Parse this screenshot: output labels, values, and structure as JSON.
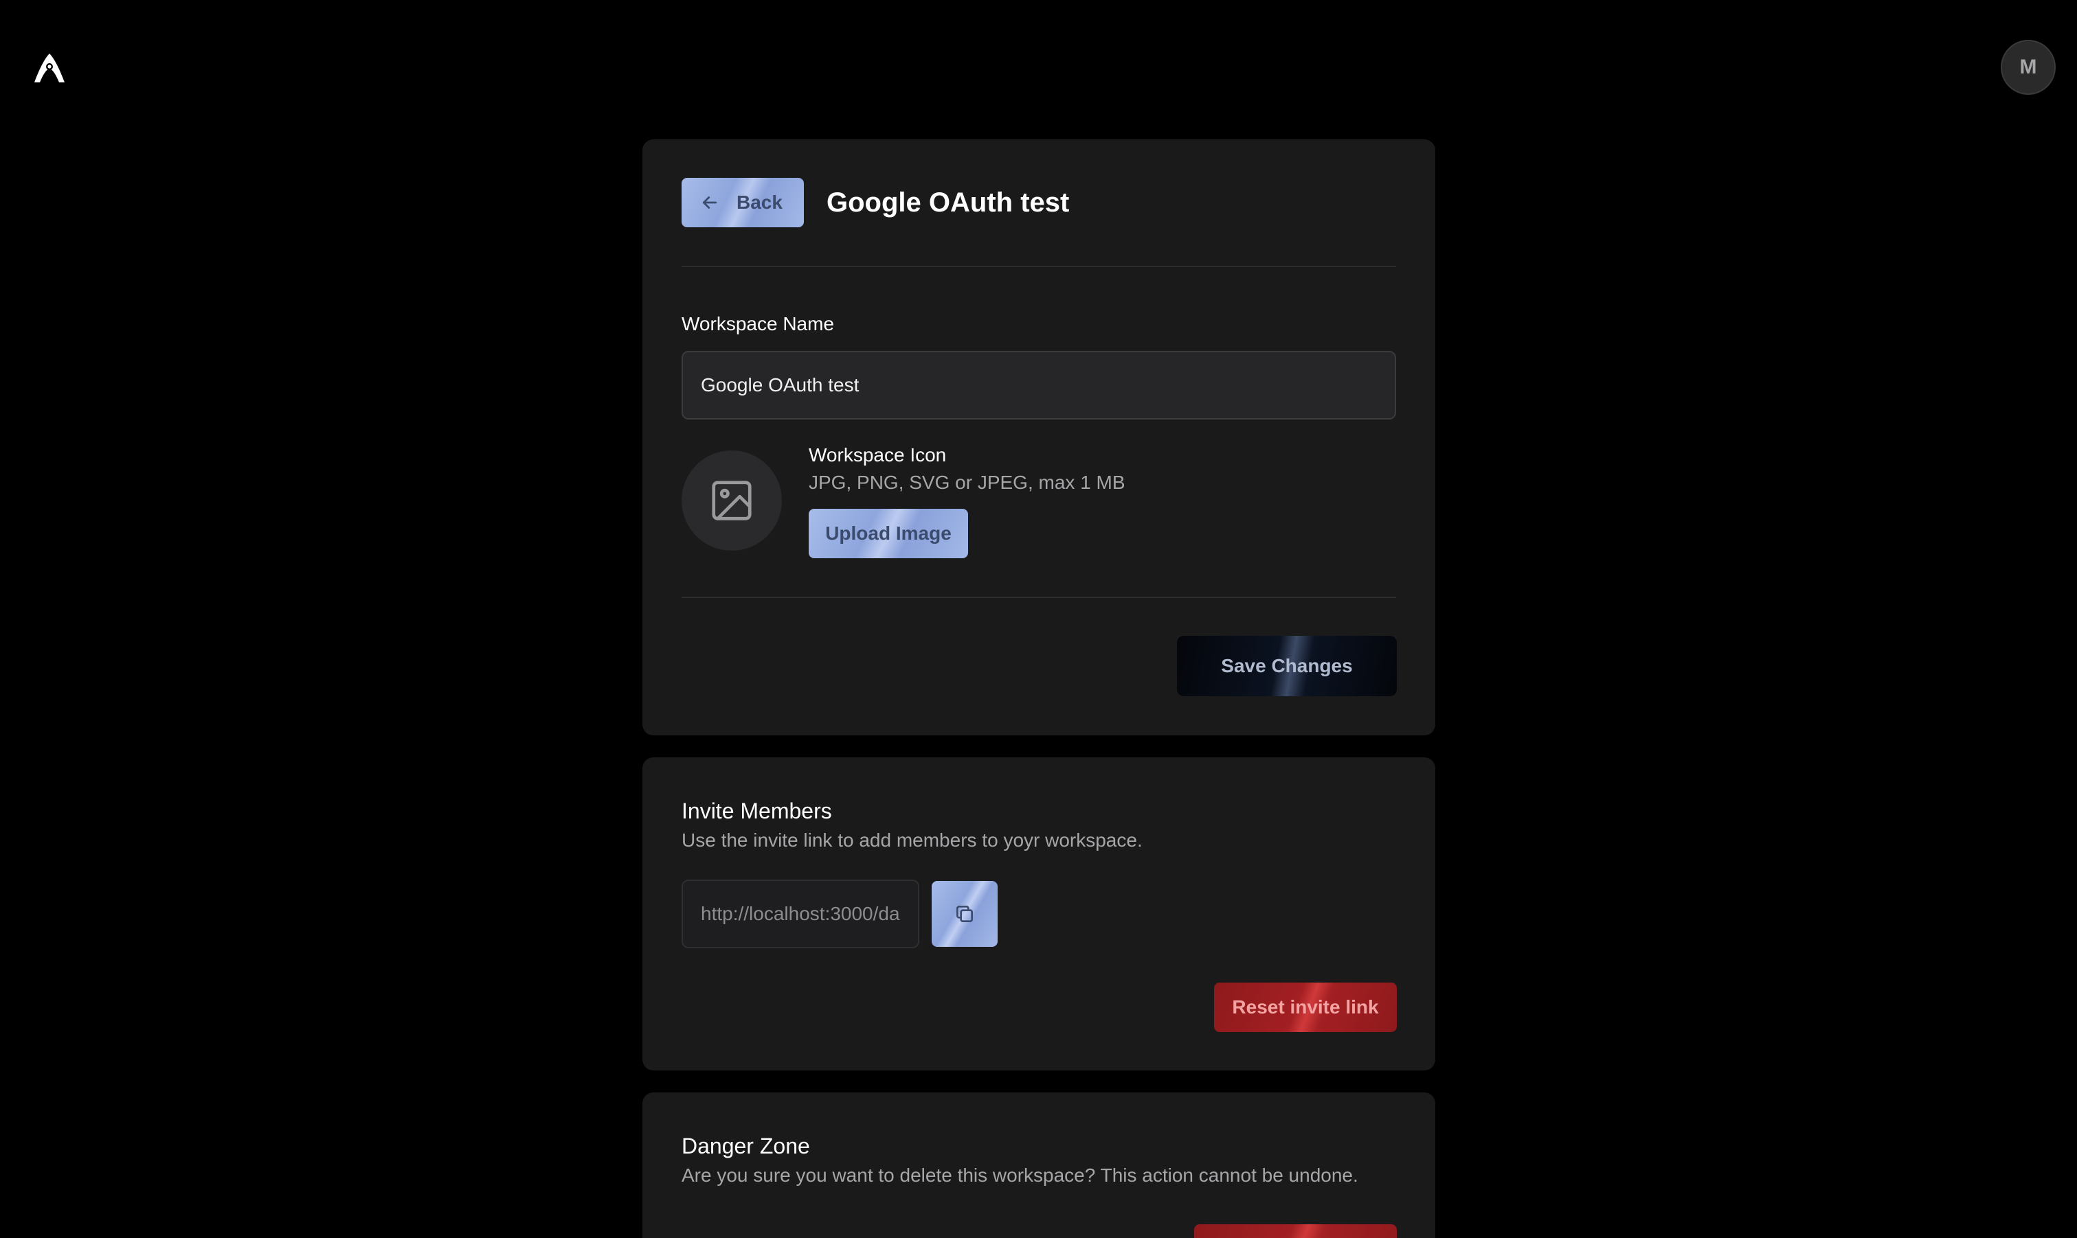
{
  "header": {
    "logo_icon": "rocket-logo-icon",
    "avatar_initial": "M"
  },
  "workspace": {
    "back_label": "Back",
    "title": "Google OAuth test",
    "name_label": "Workspace Name",
    "name_value": "Google OAuth test",
    "icon_title": "Workspace Icon",
    "icon_hint": "JPG, PNG, SVG or JPEG, max 1 MB",
    "upload_label": "Upload Image",
    "save_label": "Save Changes"
  },
  "invite": {
    "title": "Invite Members",
    "description": "Use the invite link to add members to yoyr workspace.",
    "link_value": "http://localhost:3000/da",
    "copy_icon": "copy-icon",
    "reset_label": "Reset invite link"
  },
  "danger": {
    "title": "Danger Zone",
    "description": "Are you sure you want to delete this workspace? This action cannot be undone."
  },
  "colors": {
    "background": "#000000",
    "card": "#1a1a1b",
    "accent": "#9fb4e6",
    "danger": "#a21f22"
  }
}
